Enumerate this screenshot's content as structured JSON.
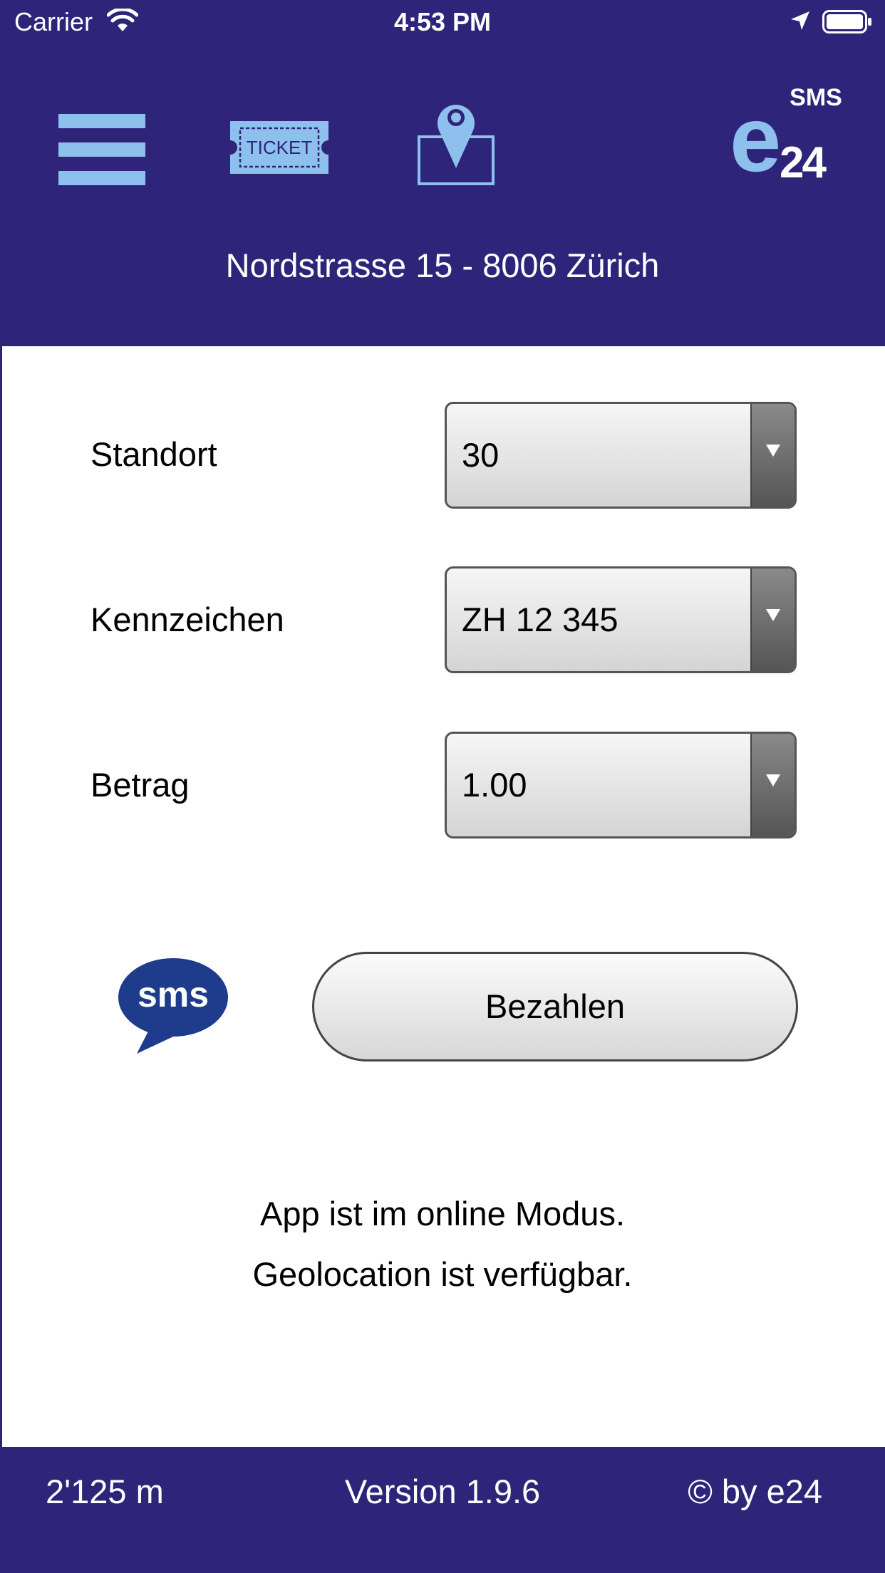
{
  "status_bar": {
    "carrier": "Carrier",
    "time": "4:53 PM",
    "icons": [
      "wifi-icon",
      "location-arrow-icon",
      "battery-icon"
    ]
  },
  "header": {
    "menu_icon": "hamburger-menu-icon",
    "ticket_label": "TICKET",
    "map_icon": "map-pin-icon",
    "logo_sms": "SMS",
    "logo_e": "e",
    "logo_24": "24",
    "address": "Nordstrasse 15 - 8006 Zürich"
  },
  "form": {
    "rows": [
      {
        "label": "Standort",
        "value": "30"
      },
      {
        "label": "Kennzeichen",
        "value": "ZH 12 345"
      },
      {
        "label": "Betrag",
        "value": "1.00"
      }
    ],
    "sms_icon_text": "sms",
    "pay_button": "Bezahlen"
  },
  "messages": {
    "online": "App ist im online Modus.",
    "geo": "Geolocation ist verfügbar."
  },
  "footer": {
    "distance": "2'125 m",
    "version": "Version 1.9.6",
    "copyright": "© by e24"
  },
  "colors": {
    "header_bg": "#2e2479",
    "accent_light_blue": "#8ec0ee",
    "sms_bubble": "#1f3c8c"
  }
}
